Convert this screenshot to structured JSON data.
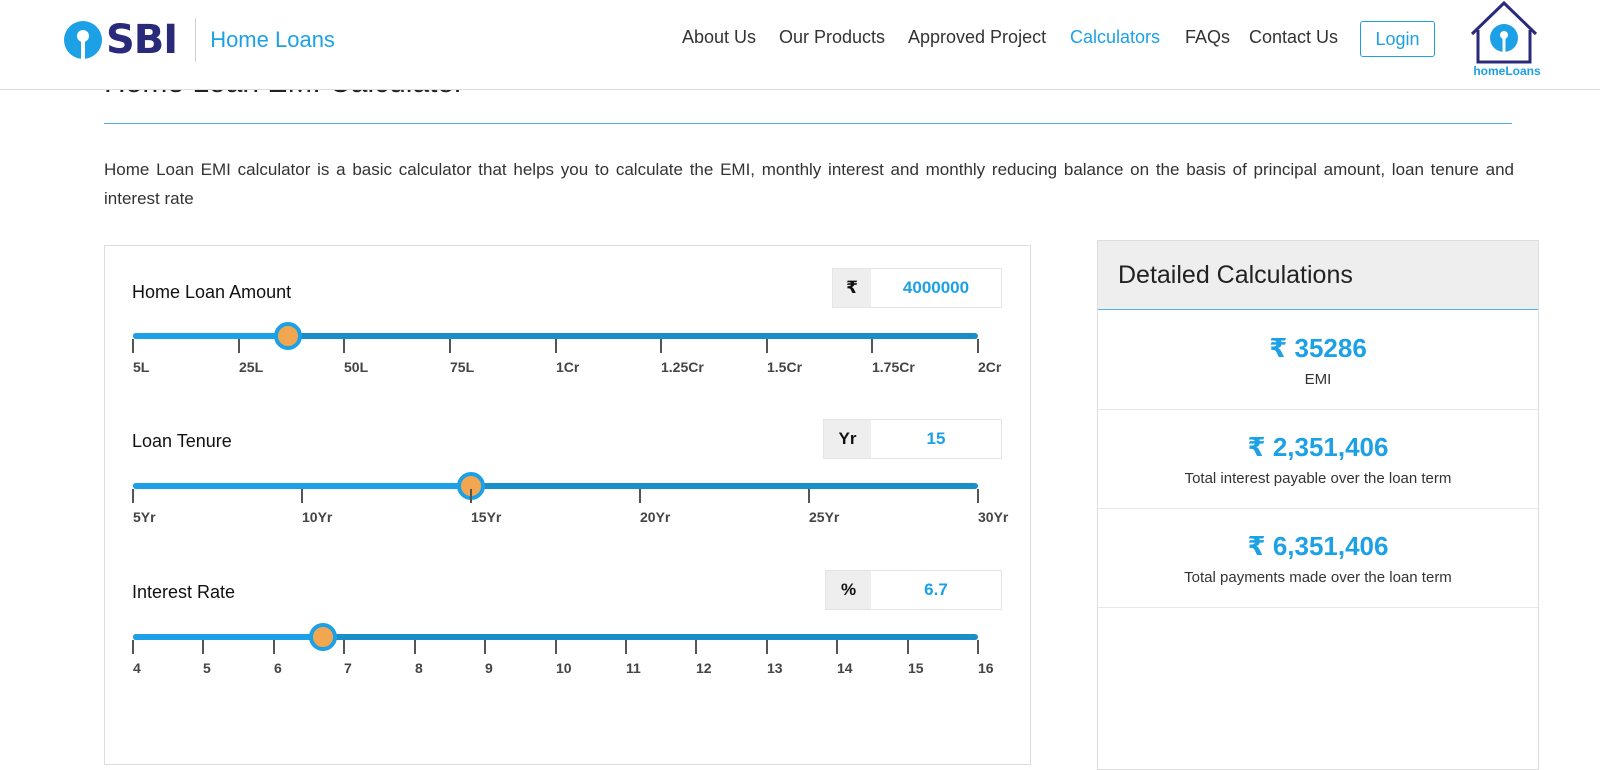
{
  "header": {
    "brand": "SBI",
    "brand_sub": "Home Loans",
    "nav": [
      "About Us",
      "Our Products",
      "Approved Project",
      "Calculators",
      "FAQs",
      "Contact Us"
    ],
    "active_nav": "Calculators",
    "login_label": "Login",
    "home_logo_text": "homeLoans"
  },
  "page": {
    "title": "Home Loan EMI Calculator",
    "intro": "Home Loan EMI calculator is a basic calculator that helps you to calculate the EMI, monthly interest and monthly reducing balance on the basis of principal amount, loan tenure and interest rate"
  },
  "calculator": {
    "amount": {
      "label": "Home Loan Amount",
      "prefix": "₹",
      "value": "4000000",
      "slider_fraction": 0.184,
      "ticks": [
        "5L",
        "25L",
        "50L",
        "75L",
        "1Cr",
        "1.25Cr",
        "1.5Cr",
        "1.75Cr",
        "2Cr"
      ]
    },
    "tenure": {
      "label": "Loan Tenure",
      "prefix": "Yr",
      "value": "15",
      "slider_fraction": 0.4,
      "ticks": [
        "5Yr",
        "10Yr",
        "15Yr",
        "20Yr",
        "25Yr",
        "30Yr"
      ]
    },
    "rate": {
      "label": "Interest Rate",
      "prefix": "%",
      "value": "6.7",
      "slider_fraction": 0.225,
      "ticks": [
        "4",
        "5",
        "6",
        "7",
        "8",
        "9",
        "10",
        "11",
        "12",
        "13",
        "14",
        "15",
        "16"
      ]
    }
  },
  "details": {
    "title": "Detailed Calculations",
    "items": [
      {
        "amount": "₹ 35286",
        "caption": "EMI"
      },
      {
        "amount": "₹ 2,351,406",
        "caption": "Total interest payable over the loan term"
      },
      {
        "amount": "₹ 6,351,406",
        "caption": "Total payments made over the loan term"
      }
    ]
  },
  "colors": {
    "accent": "#1da1e6",
    "brand_navy": "#2a2a7a",
    "handle": "#f2a650"
  }
}
